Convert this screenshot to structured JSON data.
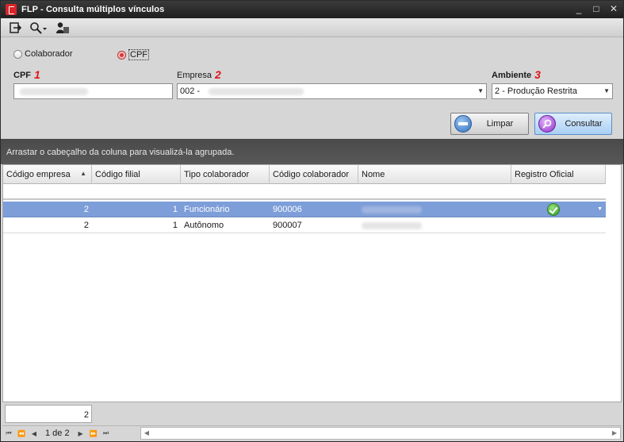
{
  "window": {
    "title": "FLP - Consulta múltiplos vínculos",
    "controls": {
      "minimize": "_",
      "maximize": "□",
      "close": "✕"
    }
  },
  "toolbar": {
    "icons": [
      "exit-icon",
      "search-icon",
      "dropdown-arrow-icon",
      "user-icon"
    ]
  },
  "filter": {
    "radio_colaborador": "Colaborador",
    "radio_cpf": "CPF",
    "selected_radio": "CPF",
    "cpf_label": "CPF",
    "cpf_number": "1",
    "cpf_value": "",
    "empresa_label": "Empresa",
    "empresa_number": "2",
    "empresa_value": "002 -",
    "ambiente_label": "Ambiente",
    "ambiente_number": "3",
    "ambiente_value": "2 - Produção Restrita",
    "btn_limpar": "Limpar",
    "btn_consultar": "Consultar"
  },
  "group_panel": {
    "hint": "Arrastar o cabeçalho da coluna para visualizá-la agrupada."
  },
  "grid": {
    "columns": [
      "Código empresa",
      "Código filial",
      "Tipo colaborador",
      "Código colaborador",
      "Nome",
      "Registro Oficial"
    ],
    "sort_column": "Código empresa",
    "sort_direction": "asc",
    "rows": [
      {
        "codigo_empresa": "2",
        "codigo_filial": "1",
        "tipo": "Funcionário",
        "codigo_colaborador": "900006",
        "nome": "",
        "registro_oficial": true,
        "selected": true
      },
      {
        "codigo_empresa": "2",
        "codigo_filial": "1",
        "tipo": "Autônomo",
        "codigo_colaborador": "900007",
        "nome": "",
        "registro_oficial": false,
        "selected": false
      }
    ]
  },
  "footer": {
    "count": "2"
  },
  "pager": {
    "page_text": "1 de 2"
  },
  "colors": {
    "selected_row": "#7d9ed8",
    "accent_number": "#e0161b",
    "group_panel": "#4f4f4f",
    "title_bar": "#2b2b2b"
  }
}
